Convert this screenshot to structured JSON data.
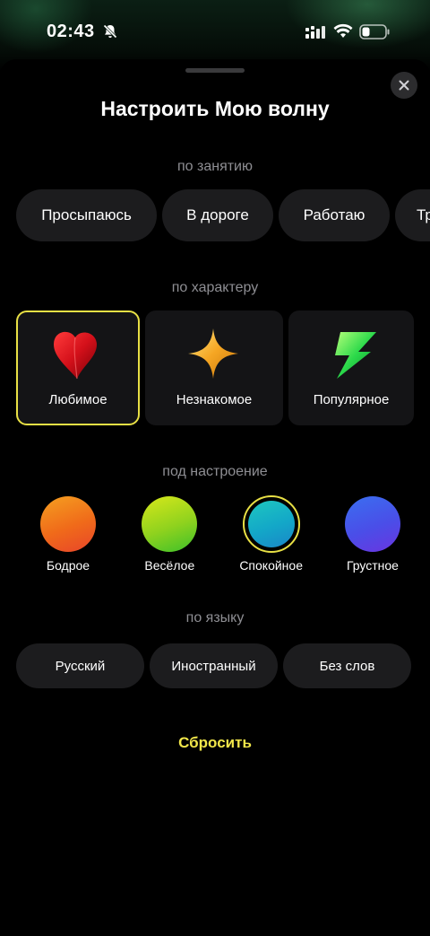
{
  "status_bar": {
    "time": "02:43"
  },
  "sheet": {
    "title": "Настроить Мою волну",
    "reset_label": "Сбросить"
  },
  "activity": {
    "label": "по занятию",
    "options": [
      "Просыпаюсь",
      "В дороге",
      "Работаю",
      "Тр"
    ]
  },
  "character": {
    "label": "по характеру",
    "options": [
      {
        "label": "Любимое",
        "icon": "red-heart-icon",
        "selected": true
      },
      {
        "label": "Незнакомое",
        "icon": "gold-sparkle-icon",
        "selected": false
      },
      {
        "label": "Популярное",
        "icon": "green-lightning-icon",
        "selected": false
      }
    ]
  },
  "mood": {
    "label": "под настроение",
    "options": [
      {
        "label": "Бодрое",
        "selected": false
      },
      {
        "label": "Весёлое",
        "selected": false
      },
      {
        "label": "Спокойное",
        "selected": true
      },
      {
        "label": "Грустное",
        "selected": false
      }
    ]
  },
  "language": {
    "label": "по языку",
    "options": [
      "Русский",
      "Иностранный",
      "Без слов"
    ]
  },
  "colors": {
    "accent": "#e8e045",
    "reset_text": "#f2e74a",
    "chip_bg": "#1c1c1e"
  }
}
